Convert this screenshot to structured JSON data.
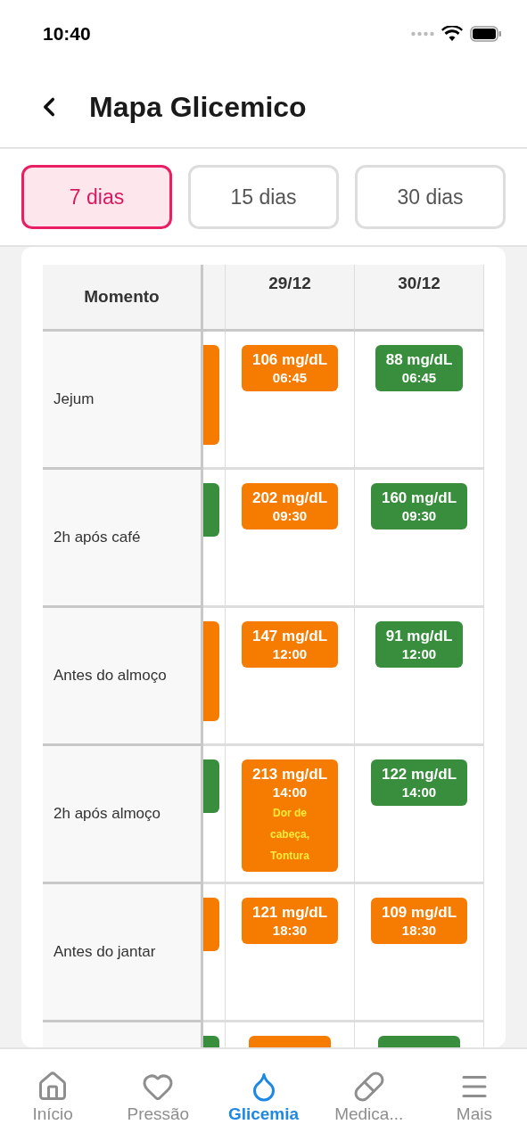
{
  "status_bar": {
    "time": "10:40"
  },
  "header": {
    "title": "Mapa Glicemico"
  },
  "periods": [
    {
      "label": "7 dias",
      "selected": true
    },
    {
      "label": "15 dias",
      "selected": false
    },
    {
      "label": "30 dias",
      "selected": false
    }
  ],
  "table": {
    "first_column": "Momento",
    "columns": [
      "29/12",
      "30/12"
    ],
    "rows": [
      {
        "label": "Jejum",
        "cut_reading": {
          "color": "#f57c00",
          "tall": true
        },
        "readings": [
          {
            "value": "106 mg/dL",
            "time": "06:45",
            "color": "#f57c00"
          },
          {
            "value": "88 mg/dL",
            "time": "06:45",
            "color": "#388e3c"
          }
        ]
      },
      {
        "label": "2h após café",
        "cut_reading": {
          "color": "#388e3c",
          "tall": false
        },
        "readings": [
          {
            "value": "202 mg/dL",
            "time": "09:30",
            "color": "#f57c00"
          },
          {
            "value": "160 mg/dL",
            "time": "09:30",
            "color": "#388e3c"
          }
        ]
      },
      {
        "label": "Antes do almoço",
        "cut_reading": {
          "color": "#f57c00",
          "tall": true
        },
        "readings": [
          {
            "value": "147 mg/dL",
            "time": "12:00",
            "color": "#f57c00"
          },
          {
            "value": "91 mg/dL",
            "time": "12:00",
            "color": "#388e3c"
          }
        ]
      },
      {
        "label": "2h após almoço",
        "cut_reading": {
          "color": "#388e3c",
          "tall": false
        },
        "readings": [
          {
            "value": "213 mg/dL",
            "time": "14:00",
            "note": "Dor de cabeça, Tontura",
            "color": "#f57c00"
          },
          {
            "value": "122 mg/dL",
            "time": "14:00",
            "color": "#388e3c"
          }
        ]
      },
      {
        "label": "Antes do jantar",
        "cut_reading": {
          "color": "#f57c00",
          "tall": false
        },
        "readings": [
          {
            "value": "121 mg/dL",
            "time": "18:30",
            "color": "#f57c00"
          },
          {
            "value": "109 mg/dL",
            "time": "18:30",
            "color": "#f57c00"
          }
        ]
      },
      {
        "cut_reading": {
          "color": "#388e3c",
          "tall": false
        },
        "readings": [
          {
            "color": "#f57c00"
          },
          {
            "color": "#388e3c"
          }
        ]
      }
    ]
  },
  "tab_bar": [
    {
      "label": "Início",
      "selected": false
    },
    {
      "label": "Pressão",
      "selected": false
    },
    {
      "label": "Glicemia",
      "selected": true
    },
    {
      "label": "Medica...",
      "selected": false
    },
    {
      "label": "Mais",
      "selected": false
    }
  ]
}
